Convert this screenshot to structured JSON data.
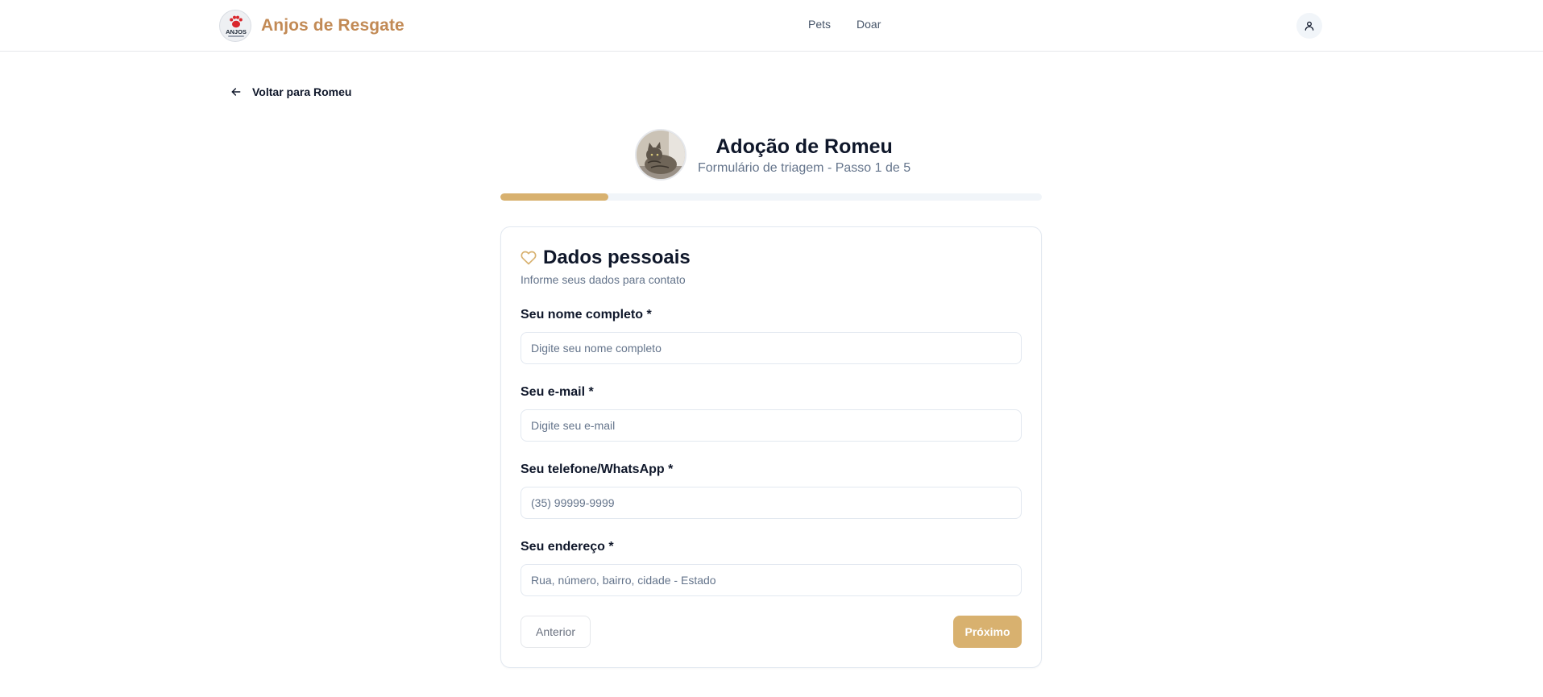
{
  "header": {
    "brand_name": "Anjos de Resgate",
    "logo_text": "ANJOS",
    "nav": [
      "Pets",
      "Doar"
    ],
    "accent_color": "#c28a55"
  },
  "back_link": {
    "label": "Voltar para Romeu",
    "icon": "arrow-left-icon"
  },
  "pet": {
    "title": "Adoção de Romeu",
    "subtitle": "Formulário de triagem - Passo 1 de 5"
  },
  "progress": {
    "step": 1,
    "total": 5,
    "fraction": 0.2,
    "color": "#d8b16f"
  },
  "card": {
    "icon": "heart-icon",
    "title": "Dados pessoais",
    "description": "Informe seus dados para contato",
    "fields": [
      {
        "label": "Seu nome completo *",
        "placeholder": "Digite seu nome completo",
        "value": ""
      },
      {
        "label": "Seu e-mail *",
        "placeholder": "Digite seu e-mail",
        "value": ""
      },
      {
        "label": "Seu telefone/WhatsApp *",
        "placeholder": "(35) 99999-9999",
        "value": ""
      },
      {
        "label": "Seu endereço *",
        "placeholder": "Rua, número, bairro, cidade - Estado",
        "value": ""
      }
    ],
    "prev_label": "Anterior",
    "next_label": "Próximo"
  }
}
